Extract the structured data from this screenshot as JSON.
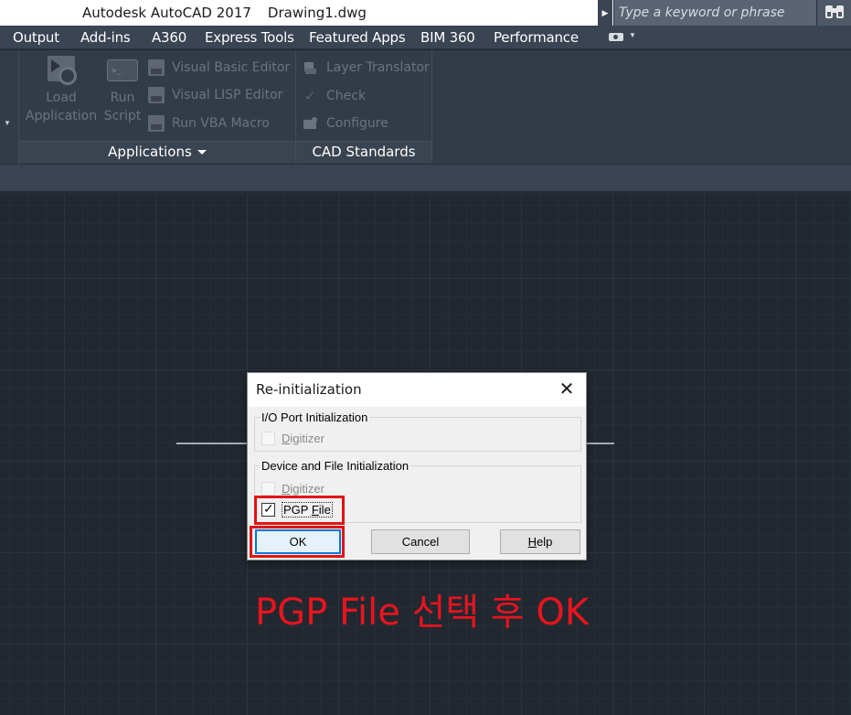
{
  "titlebar": {
    "app_title": "Autodesk AutoCAD 2017",
    "document": "Drawing1.dwg",
    "search_placeholder": "Type a keyword or phrase"
  },
  "menu_tabs": [
    "Output",
    "Add-ins",
    "A360",
    "Express Tools",
    "Featured Apps",
    "BIM 360",
    "Performance"
  ],
  "ribbon": {
    "applications_panel": {
      "title": "Applications",
      "load_application": {
        "line1": "Load",
        "line2": "Application",
        "icon": "load-application-icon"
      },
      "run_script": {
        "line1": "Run",
        "line2": "Script",
        "icon": "run-script-icon"
      },
      "small_buttons": [
        "Visual Basic Editor",
        "Visual LISP Editor",
        "Run VBA Macro"
      ]
    },
    "cad_standards_panel": {
      "title": "CAD Standards",
      "small_buttons": [
        "Layer Translator",
        "Check",
        "Configure"
      ]
    }
  },
  "dialog": {
    "title": "Re-initialization",
    "io_group": {
      "legend": "I/O Port Initialization",
      "digitizer_label": "Digitizer",
      "digitizer_checked": false,
      "digitizer_enabled": false
    },
    "device_group": {
      "legend": "Device and File Initialization",
      "digitizer_label": "Digitizer",
      "digitizer_checked": false,
      "digitizer_enabled": false,
      "pgp_label": "PGP File",
      "pgp_checked": true
    },
    "buttons": {
      "ok": "OK",
      "cancel": "Cancel",
      "help": "Help"
    }
  },
  "annotation": "PGP File 선택 후 OK",
  "colors": {
    "canvas_bg": "#212830",
    "ribbon_bg": "#333b47",
    "highlight_red": "#e01414",
    "annotation_red": "#e8141e",
    "default_button_border": "#0078d7"
  }
}
